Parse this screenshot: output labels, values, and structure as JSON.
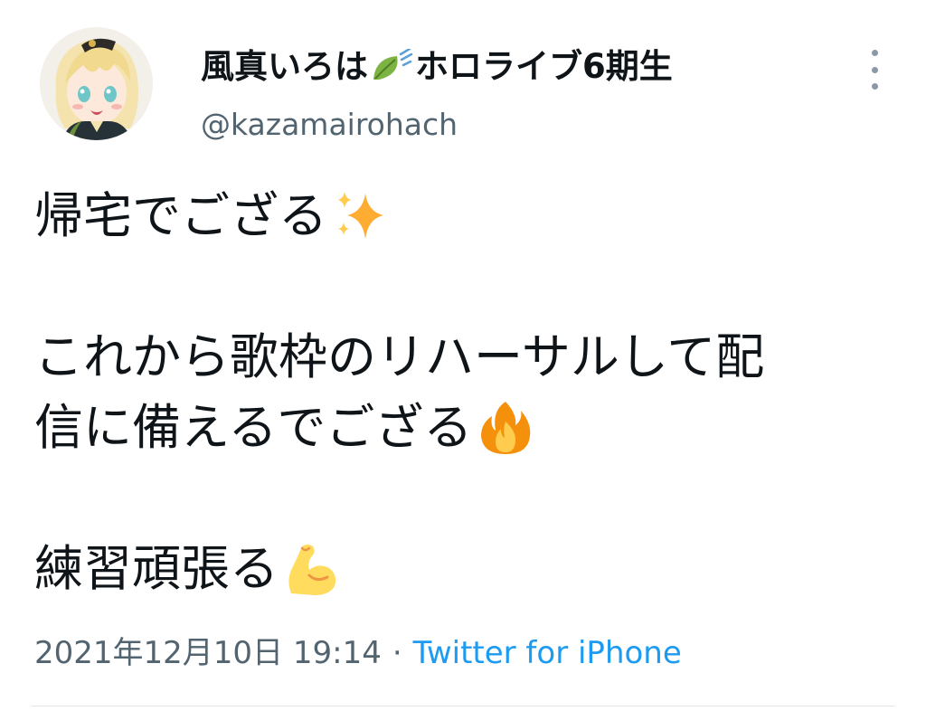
{
  "header": {
    "display_name_prefix": "風真いろは",
    "display_name_suffix": "ホロライブ6期生",
    "name_icon": "leaf-icon",
    "username": "@kazamairohach",
    "more_icon": "more-vertical-icon"
  },
  "tweet": {
    "lines": [
      {
        "text": "帰宅でござる",
        "emoji": "sparkles-icon"
      },
      {
        "text": ""
      },
      {
        "text": "これから歌枠のリハーサルして配"
      },
      {
        "text": "信に備えるでござる",
        "emoji": "fire-icon"
      },
      {
        "text": ""
      },
      {
        "text": "練習頑張る",
        "emoji": "flexed-biceps-icon"
      }
    ]
  },
  "meta": {
    "timestamp": "2021年12月10日 19:14",
    "separator": "·",
    "source": "Twitter for iPhone"
  },
  "colors": {
    "text": "#0f1419",
    "secondary": "#536471",
    "link": "#1d9bf0",
    "divider": "#e3e6e9"
  }
}
